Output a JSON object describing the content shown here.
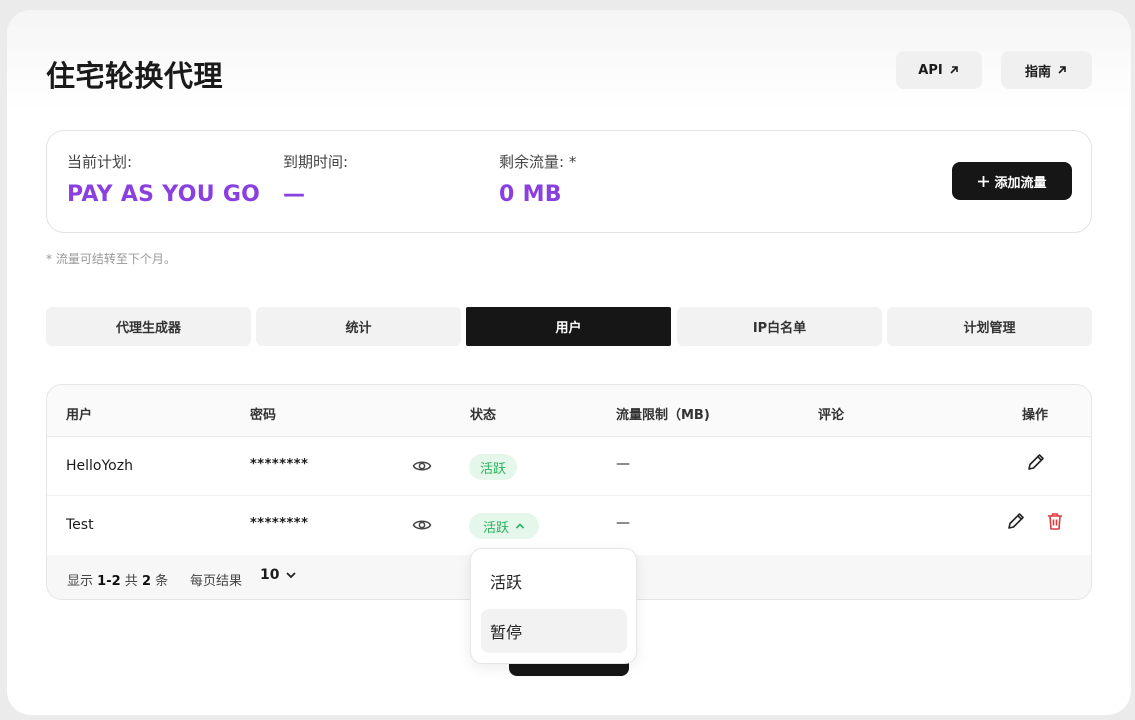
{
  "page": {
    "title": "住宅轮换代理",
    "api_label": "API",
    "guide_label": "指南"
  },
  "plan": {
    "current_plan_label": "当前计划:",
    "current_plan_value": "PAY AS YOU GO",
    "expiry_label": "到期时间:",
    "expiry_value": "—",
    "traffic_label": "剩余流量: *",
    "traffic_value": "0 MB",
    "add_traffic_label": "添加流量",
    "note": "* 流量可结转至下个月。"
  },
  "tabs": [
    {
      "label": "代理生成器",
      "active": false
    },
    {
      "label": "统计",
      "active": false
    },
    {
      "label": "用户",
      "active": true
    },
    {
      "label": "IP白名单",
      "active": false
    },
    {
      "label": "计划管理",
      "active": false
    }
  ],
  "table": {
    "headers": {
      "user": "用户",
      "password": "密码",
      "status": "状态",
      "limit": "流量限制（MB)",
      "comment": "评论",
      "actions": "操作"
    },
    "rows": [
      {
        "user": "HelloYozh",
        "password": "********",
        "status": "活跃",
        "limit": "—",
        "comment": ""
      },
      {
        "user": "Test",
        "password": "********",
        "status": "活跃",
        "limit": "—",
        "comment": ""
      }
    ],
    "footer": {
      "show": "显示",
      "range": "1-2",
      "total_word": "共",
      "total": "2",
      "unit": "条",
      "per_page_label": "每页结果",
      "per_page_value": "10"
    }
  },
  "status_dropdown": {
    "options": [
      "活跃",
      "暂停"
    ],
    "highlighted": "暂停"
  },
  "colors": {
    "accent_purple": "#8a3fe0",
    "active_green": "#27b35b",
    "delete_red": "#e0393e",
    "dark": "#161616"
  },
  "icons": {
    "external": "arrow-up-right-icon",
    "plus": "plus-icon",
    "eye": "eye-icon",
    "edit": "pencil-icon",
    "delete": "trash-icon",
    "chevron": "chevron-icon"
  }
}
